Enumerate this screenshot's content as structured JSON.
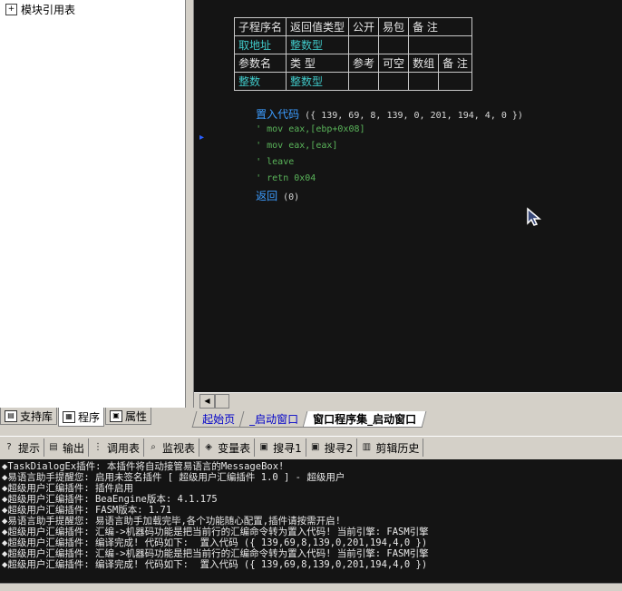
{
  "left_panel": {
    "tree_item": {
      "icon": "module-icon",
      "label": "模块引用表"
    },
    "tabs": [
      {
        "icon": "library-icon",
        "label": "支持库",
        "active": false
      },
      {
        "icon": "program-icon",
        "label": "程序",
        "active": true
      },
      {
        "icon": "property-icon",
        "label": "属性",
        "active": false
      }
    ]
  },
  "editor": {
    "table": {
      "header1": [
        "子程序名",
        "返回值类型",
        "公开",
        "易包",
        "备 注"
      ],
      "row1": [
        "取地址",
        "整数型",
        "",
        "",
        ""
      ],
      "header2": [
        "参数名",
        "类 型",
        "参考",
        "可空",
        "数组",
        "备 注"
      ],
      "row2": [
        "整数",
        "整数型",
        "",
        "",
        "",
        ""
      ]
    },
    "code_lines": [
      {
        "keyword": "置入代码",
        "args": " ({ 139, 69, 8, 139, 0, 201, 194, 4, 0 })"
      },
      {
        "comment": "' mov eax,[ebp+0x08]"
      },
      {
        "comment": "' mov eax,[eax]"
      },
      {
        "comment": "' leave"
      },
      {
        "comment": "' retn 0x04"
      },
      {
        "keyword": "返回",
        "args": " (0)"
      }
    ]
  },
  "editor_tabs": [
    {
      "label": "起始页",
      "style": "link"
    },
    {
      "label": "_启动窗口",
      "style": "link"
    },
    {
      "label": "窗口程序集_启动窗口",
      "style": "active"
    }
  ],
  "bottom_toolbar": [
    {
      "icon": "hint-icon",
      "label": "提示"
    },
    {
      "icon": "output-icon",
      "label": "输出"
    },
    {
      "icon": "call-stack-icon",
      "label": "调用表"
    },
    {
      "icon": "watch-icon",
      "label": "监视表"
    },
    {
      "icon": "variable-icon",
      "label": "变量表"
    },
    {
      "icon": "search1-icon",
      "label": "搜寻1"
    },
    {
      "icon": "search2-icon",
      "label": "搜寻2"
    },
    {
      "icon": "clipboard-icon",
      "label": "剪辑历史"
    }
  ],
  "output_lines": [
    "◆TaskDialogEx插件: 本插件将自动接管易语言的MessageBox!",
    "◆易语言助手提醒您: 启用未签名插件 [ 超级用户汇编插件 1.0 ] - 超级用户",
    "◆超级用户汇编插件: 插件启用",
    "◆超级用户汇编插件: BeaEngine版本: 4.1.175",
    "◆超级用户汇编插件: FASM版本: 1.71",
    "◆易语言助手提醒您: 易语言助手加载完毕,各个功能随心配置,插件请按需开启!",
    "◆超级用户汇编插件: 汇编->机器码功能是把当前行的汇编命令转为置入代码! 当前引擎: FASM引擎",
    "◆超级用户汇编插件: 编译完成! 代码如下:  置入代码 ({ 139,69,8,139,0,201,194,4,0 })",
    "◆超级用户汇编插件: 汇编->机器码功能是把当前行的汇编命令转为置入代码! 当前引擎: FASM引擎",
    "◆超级用户汇编插件: 编译完成! 代码如下:  置入代码 ({ 139,69,8,139,0,201,194,4,0 })"
  ],
  "colors": {
    "editor_bg": "#141414",
    "keyword": "#3c9cff",
    "comment": "#5ab45a",
    "cyan_cell": "#40c8c8"
  }
}
